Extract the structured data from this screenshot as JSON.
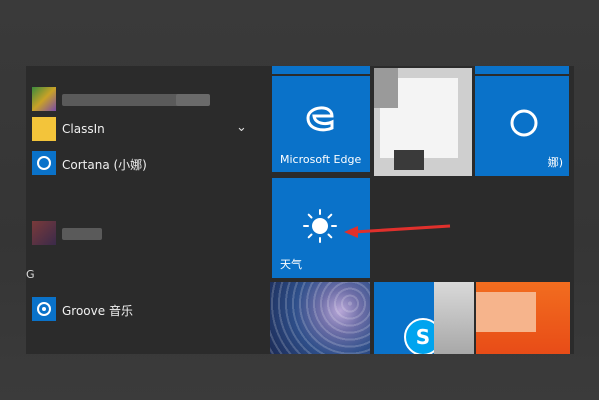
{
  "app_list": {
    "items": [
      {
        "label": "ClassIn"
      },
      {
        "label": "Cortana (小娜)"
      },
      {
        "label": "Groove 音乐"
      }
    ],
    "section_letter": "G"
  },
  "tiles": {
    "edge": {
      "label": "Microsoft Edge"
    },
    "weather": {
      "label": "天气"
    },
    "cortana_partial": {
      "label": "娜)"
    }
  },
  "colors": {
    "tile_blue": "#0a72c9",
    "start_bg": "#2b2b2b",
    "arrow_red": "#e0302c",
    "skype_blue": "#00a4ef"
  }
}
